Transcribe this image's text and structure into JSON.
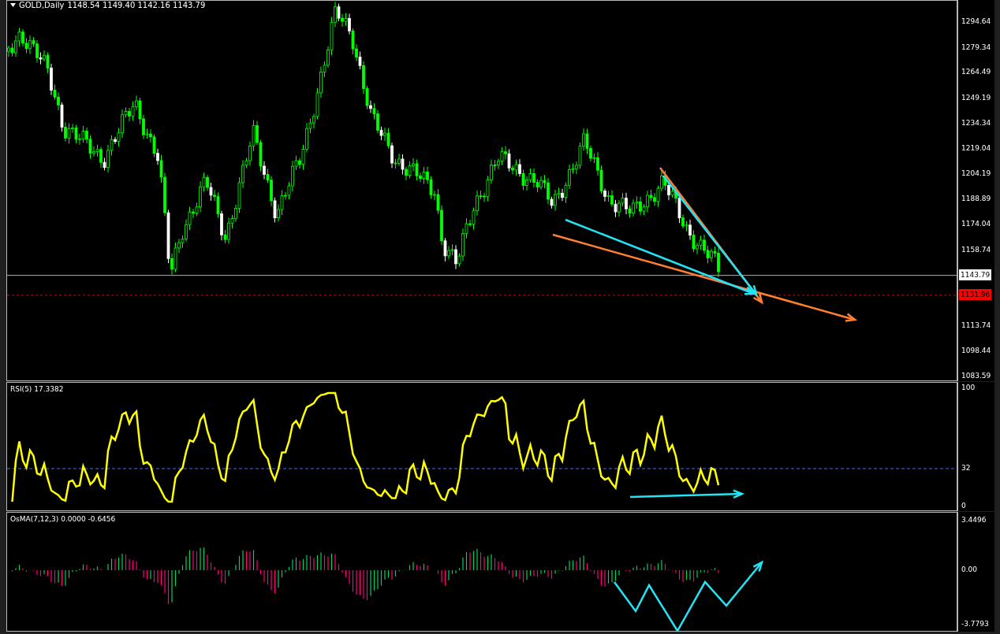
{
  "chart": {
    "symbol": "GOLD,Daily",
    "ohlc": "1148.54 1149.40 1142.16 1143.79",
    "price_ticks": [
      "1294.64",
      "1279.34",
      "1264.49",
      "1249.19",
      "1234.34",
      "1219.04",
      "1204.19",
      "1188.89",
      "1174.04",
      "1158.74",
      "1113.74",
      "1098.44",
      "1083.59"
    ],
    "bid_label": "1143.79",
    "alert_label": "1131.96"
  },
  "rsi": {
    "title": "RSI(5) 17.3382",
    "ticks": [
      "100",
      "32",
      "0"
    ]
  },
  "osma": {
    "title": "OsMA(7,12,3) 0.0000 -0.6456",
    "ticks": [
      "3.4496",
      "0.00",
      "-3.7793"
    ]
  }
}
